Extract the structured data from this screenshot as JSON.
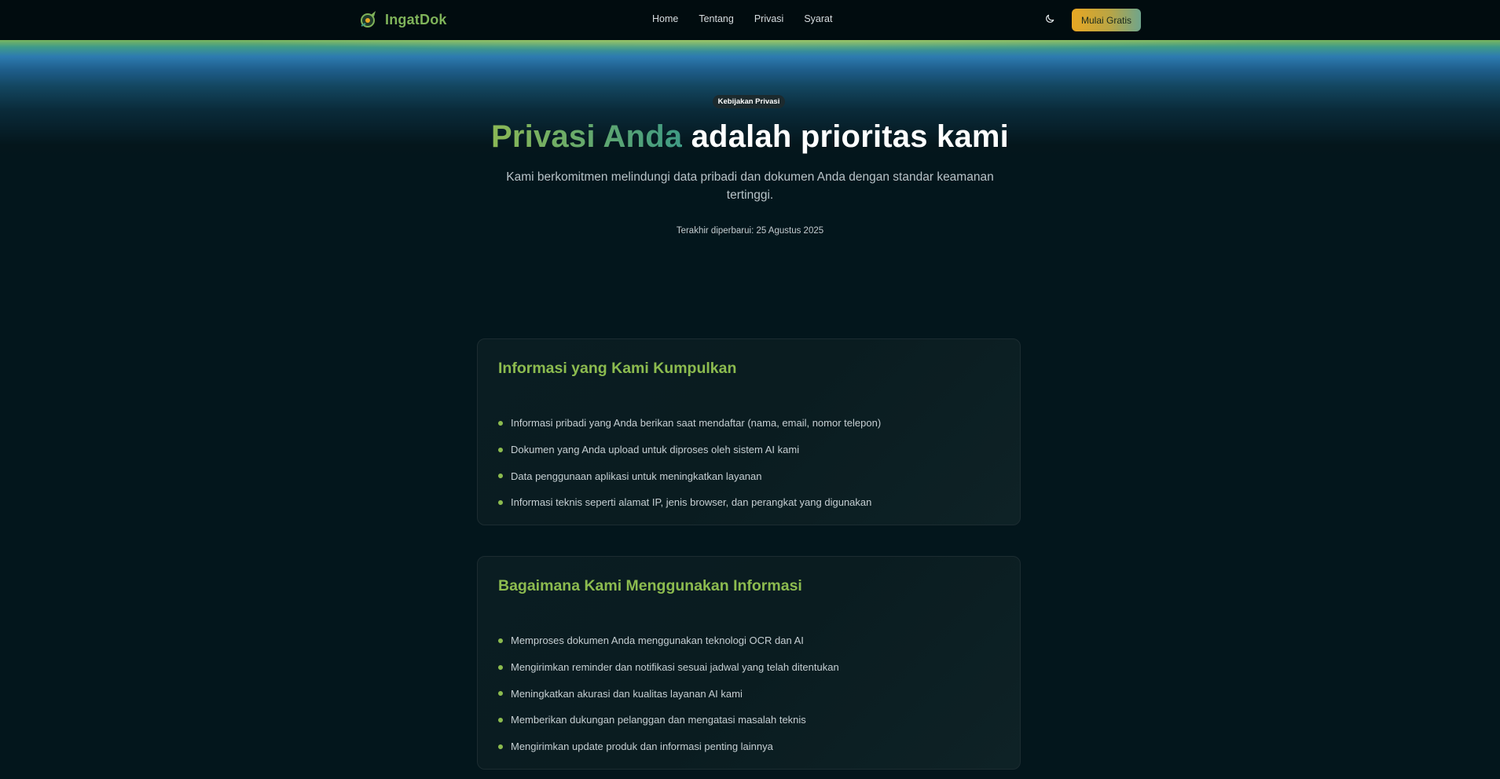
{
  "header": {
    "brand": "IngatDok",
    "nav": [
      "Home",
      "Tentang",
      "Privasi",
      "Syarat"
    ],
    "cta_label": "Mulai Gratis",
    "theme_icon": "moon-icon"
  },
  "hero": {
    "badge": "Kebijakan Privasi",
    "title_accent": "Privasi Anda",
    "title_rest": "adalah prioritas kami",
    "subtitle": "Kami berkomitmen melindungi data pribadi dan dokumen Anda dengan standar keamanan tertinggi.",
    "updated": "Terakhir diperbarui: 25 Agustus 2025"
  },
  "sections": [
    {
      "title": "Informasi yang Kami Kumpulkan",
      "items": [
        "Informasi pribadi yang Anda berikan saat mendaftar (nama, email, nomor telepon)",
        "Dokumen yang Anda upload untuk diproses oleh sistem AI kami",
        "Data penggunaan aplikasi untuk meningkatkan layanan",
        "Informasi teknis seperti alamat IP, jenis browser, dan perangkat yang digunakan"
      ]
    },
    {
      "title": "Bagaimana Kami Menggunakan Informasi",
      "items": [
        "Memproses dokumen Anda menggunakan teknologi OCR dan AI",
        "Mengirimkan reminder dan notifikasi sesuai jadwal yang telah ditentukan",
        "Meningkatkan akurasi dan kualitas layanan AI kami",
        "Memberikan dukungan pelanggan dan mengatasi masalah teknis",
        "Mengirimkan update produk dan informasi penting lainnya"
      ]
    }
  ],
  "colors": {
    "accent_green": "#8cbb4f",
    "accent_teal": "#3f9a84",
    "cta_orange": "#e8a623",
    "background": "#03161c"
  }
}
